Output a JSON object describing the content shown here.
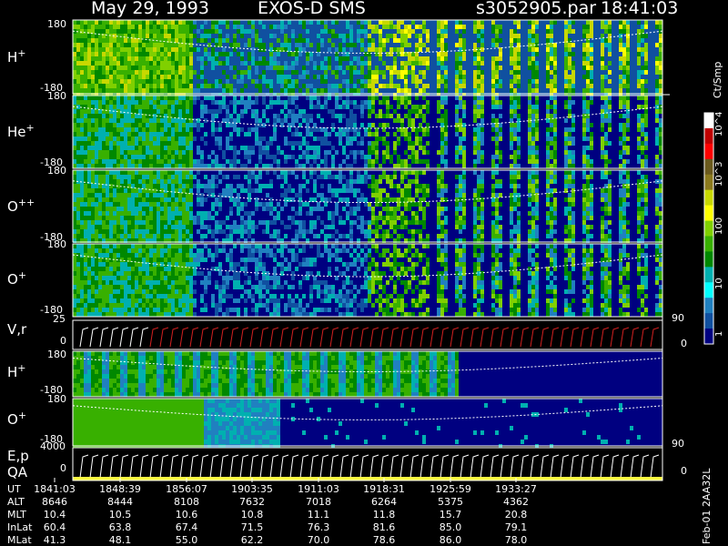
{
  "header": {
    "date": "May 29, 1993",
    "instrument": "EXOS-D SMS",
    "file": "s3052905.par",
    "time": "18:41:03"
  },
  "panels": [
    {
      "id": "h-plus-1",
      "species": "H",
      "charge": "+",
      "ytop": "180",
      "ybot": "-180"
    },
    {
      "id": "he-plus",
      "species": "He",
      "charge": "+",
      "ytop": "180",
      "ybot": "-180"
    },
    {
      "id": "o-plus-plus",
      "species": "O",
      "charge": "++",
      "ytop": "180",
      "ybot": "-180"
    },
    {
      "id": "o-plus-1",
      "species": "O",
      "charge": "+",
      "ytop": "180",
      "ybot": "-180"
    },
    {
      "id": "vr",
      "species": "V,r",
      "charge": "",
      "ytop": "25",
      "ybot": "0",
      "yright": "90",
      "yright2": "0"
    },
    {
      "id": "h-plus-2",
      "species": "H",
      "charge": "+",
      "ytop": "180",
      "ybot": "-180"
    },
    {
      "id": "o-plus-2",
      "species": "O",
      "charge": "+",
      "ytop": "180",
      "ybot": "-180"
    },
    {
      "id": "ep-qa",
      "species": "E,p",
      "species2": "QA",
      "charge": "",
      "ytop": "4000",
      "ybot": "0",
      "yright": "90",
      "yright2": "0"
    }
  ],
  "colorbar": {
    "unit": "Ct/Smp",
    "labels": [
      "10^4",
      "10^3",
      "100",
      "10",
      "1"
    ],
    "colors": [
      "#ffffff",
      "#c00000",
      "#ff0000",
      "#6b5a1e",
      "#8c7a1e",
      "#c8d800",
      "#ffff00",
      "#80d000",
      "#38b000",
      "#008800",
      "#00b0b0",
      "#00ffff",
      "#2080c0",
      "#1050a0",
      "#000080"
    ]
  },
  "table": {
    "rows": [
      {
        "label": "UT",
        "values": [
          "1841:03",
          "1848:39",
          "1856:07",
          "1903:35",
          "1911:03",
          "1918:31",
          "1925:59",
          "1933:27"
        ]
      },
      {
        "label": "ALT",
        "values": [
          "8646",
          "8444",
          "8108",
          "7632",
          "7018",
          "6264",
          "5375",
          "4362"
        ]
      },
      {
        "label": "MLT",
        "values": [
          "10.4",
          "10.5",
          "10.6",
          "10.8",
          "11.1",
          "11.8",
          "15.7",
          "20.8"
        ]
      },
      {
        "label": "InLat",
        "values": [
          "60.4",
          "63.8",
          "67.4",
          "71.5",
          "76.3",
          "81.6",
          "85.0",
          "79.1"
        ]
      },
      {
        "label": "MLat",
        "values": [
          "41.3",
          "48.1",
          "55.0",
          "62.2",
          "70.0",
          "78.6",
          "86.0",
          "78.0"
        ]
      }
    ]
  },
  "footer_label": "Feb-01 2AA32L",
  "chart_data": {
    "type": "heatmap",
    "title": "May 29, 1993   EXOS-D SMS",
    "x": [
      "1841:03",
      "1848:39",
      "1856:07",
      "1903:35",
      "1911:03",
      "1918:31",
      "1925:59",
      "1933:27"
    ],
    "series": [
      {
        "name": "H+",
        "ylim": [
          -180,
          180
        ]
      },
      {
        "name": "He+",
        "ylim": [
          -180,
          180
        ]
      },
      {
        "name": "O++",
        "ylim": [
          -180,
          180
        ]
      },
      {
        "name": "O+",
        "ylim": [
          -180,
          180
        ]
      },
      {
        "name": "V,r",
        "ylim": [
          0,
          25
        ]
      },
      {
        "name": "H+",
        "ylim": [
          -180,
          180
        ]
      },
      {
        "name": "O+",
        "ylim": [
          -180,
          180
        ]
      },
      {
        "name": "E,p",
        "ylim": [
          0,
          4000
        ]
      }
    ],
    "colorbar_range": [
      1,
      10000
    ],
    "colorbar_scale": "log"
  }
}
